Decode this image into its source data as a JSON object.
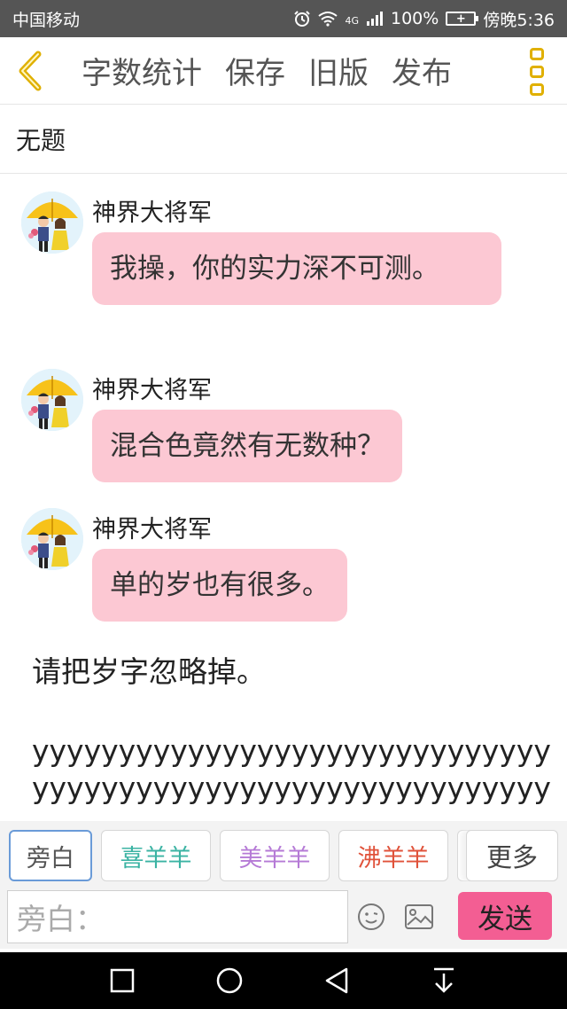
{
  "statusbar": {
    "carrier": "中国移动",
    "network": "4G",
    "battery_percent": "100%",
    "time": "傍晚5:36"
  },
  "toolbar": {
    "word_count": "字数统计",
    "save": "保存",
    "old_version": "旧版",
    "publish": "发布"
  },
  "document": {
    "title": "无题"
  },
  "messages": [
    {
      "sender": "神界大将军",
      "text": "我操，你的实力深不可测。"
    },
    {
      "sender": "神界大将军",
      "text": "混合色竟然有无数种？"
    },
    {
      "sender": "神界大将军",
      "text": "单的岁也有很多。"
    }
  ],
  "narration": "请把岁字忽略掉。",
  "repeated_text": "yyyyyyyyyyyyyyyyyyyyyyyyyyyyyyyyyyyyyyyyyyyyyyyyyyyyyyyyyyyyyyyyy",
  "roles": [
    {
      "label": "旁白",
      "color": "#555555"
    },
    {
      "label": "喜羊羊",
      "color": "#3bb3a3"
    },
    {
      "label": "美羊羊",
      "color": "#b57ad6"
    },
    {
      "label": "沸羊羊",
      "color": "#e0523a"
    }
  ],
  "more_roles": "更多",
  "input": {
    "placeholder": "旁白："
  },
  "send": "发送",
  "colors": {
    "accent": "#f35e93",
    "bubble": "#fcc8d3",
    "icon_yellow": "#e0b000"
  }
}
